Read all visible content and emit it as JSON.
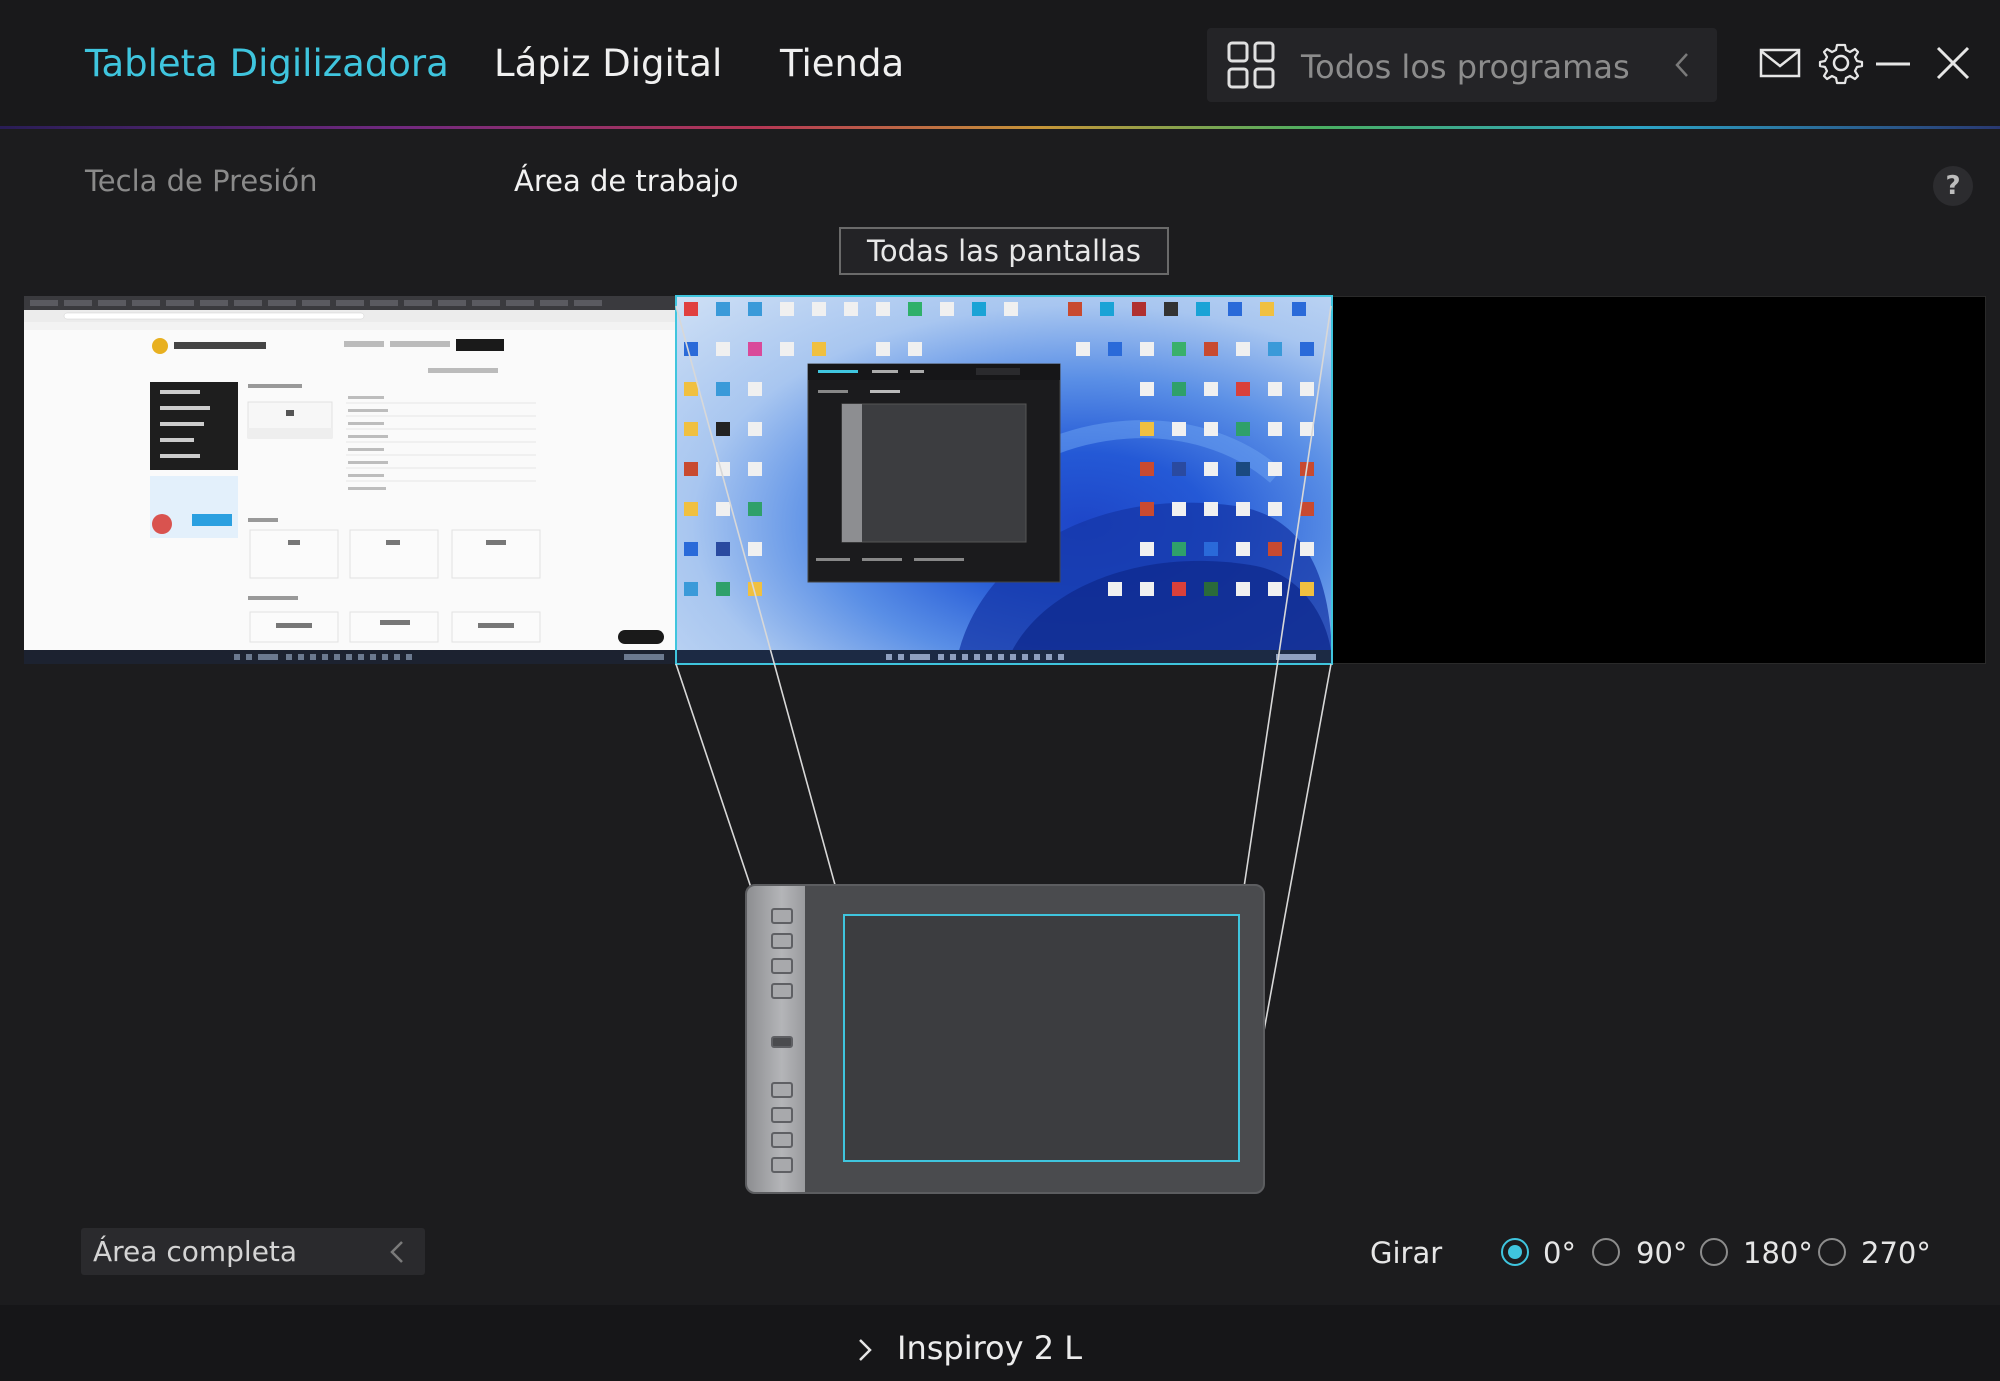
{
  "header": {
    "tabs": [
      {
        "label": "Tableta Digilizadora",
        "active": true
      },
      {
        "label": "Lápiz Digital",
        "active": false
      },
      {
        "label": "Tienda",
        "active": false
      }
    ],
    "programs": {
      "label": "Todos los programas",
      "icon": "grid-icon"
    }
  },
  "subtabs": [
    {
      "label": "Tecla de Presión",
      "active": false
    },
    {
      "label": "Área de trabajo",
      "active": true
    }
  ],
  "help": {
    "label": "?"
  },
  "screens_button": {
    "label": "Todas las pantallas"
  },
  "area": {
    "label": "Área completa"
  },
  "rotation": {
    "label": "Girar",
    "options": [
      {
        "label": "0°",
        "checked": true
      },
      {
        "label": "90°",
        "checked": false
      },
      {
        "label": "180°",
        "checked": false
      },
      {
        "label": "270°",
        "checked": false
      }
    ]
  },
  "device": {
    "name": "Inspiroy 2 L"
  },
  "colors": {
    "accent": "#3fc5de",
    "background": "#1c1c1e"
  }
}
